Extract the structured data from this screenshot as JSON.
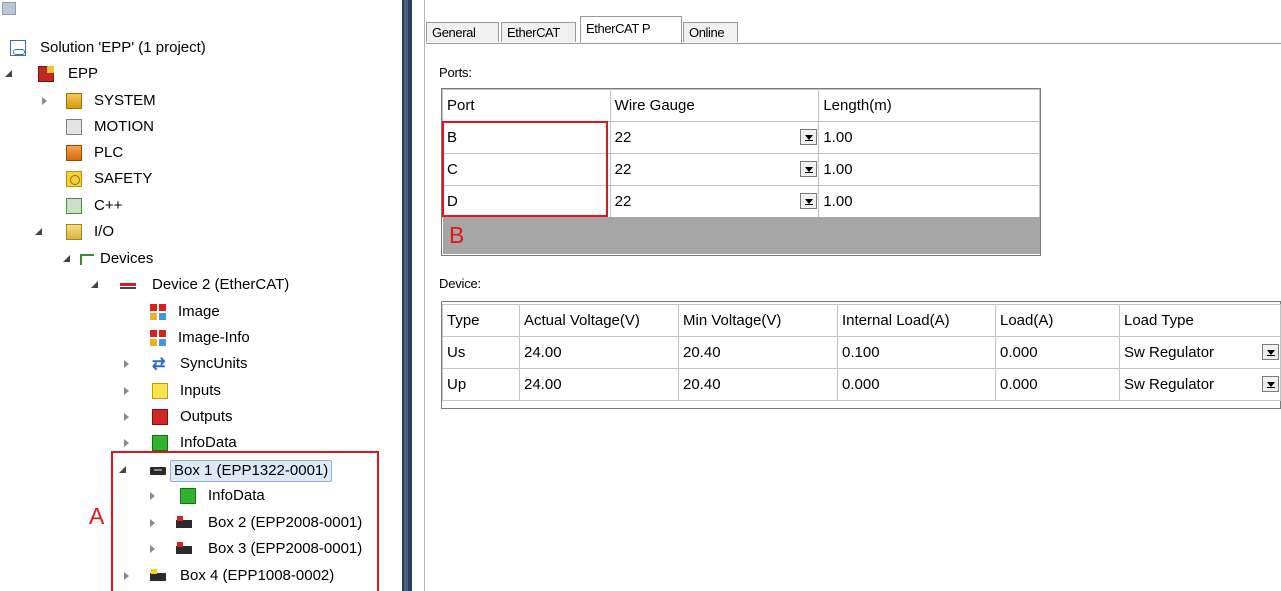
{
  "tree": {
    "solution": "Solution 'EPP' (1 project)",
    "project": "EPP",
    "system": "SYSTEM",
    "motion": "MOTION",
    "plc": "PLC",
    "safety": "SAFETY",
    "cpp": "C++",
    "io": "I/O",
    "devices": "Devices",
    "device2": "Device 2 (EtherCAT)",
    "image": "Image",
    "image_info": "Image-Info",
    "syncunits": "SyncUnits",
    "inputs": "Inputs",
    "outputs": "Outputs",
    "infodata": "InfoData",
    "box1": "Box 1 (EPP1322-0001)",
    "box1_infodata": "InfoData",
    "box2": "Box 2 (EPP2008-0001)",
    "box3": "Box 3 (EPP2008-0001)",
    "box4": "Box 4 (EPP1008-0002)"
  },
  "annotations": {
    "a": "A",
    "b": "B"
  },
  "tabs": [
    "General",
    "EtherCAT",
    "EtherCAT P",
    "Online"
  ],
  "ports": {
    "label": "Ports:",
    "headers": [
      "Port",
      "Wire Gauge",
      "Length(m)"
    ],
    "rows": [
      [
        "B",
        "22",
        "1.00"
      ],
      [
        "C",
        "22",
        "1.00"
      ],
      [
        "D",
        "22",
        "1.00"
      ]
    ]
  },
  "device": {
    "label": "Device:",
    "headers": [
      "Type",
      "Actual Voltage(V)",
      "Min Voltage(V)",
      "Internal Load(A)",
      "Load(A)",
      "Load Type"
    ],
    "rows": [
      [
        "Us",
        "24.00",
        "20.40",
        "0.100",
        "0.000",
        "Sw Regulator"
      ],
      [
        "Up",
        "24.00",
        "20.40",
        "0.000",
        "0.000",
        "Sw Regulator"
      ]
    ]
  },
  "colors": {
    "annotation": "#e0161c",
    "splitter": "#2c3e5c",
    "selection": "#dfe9f5"
  }
}
